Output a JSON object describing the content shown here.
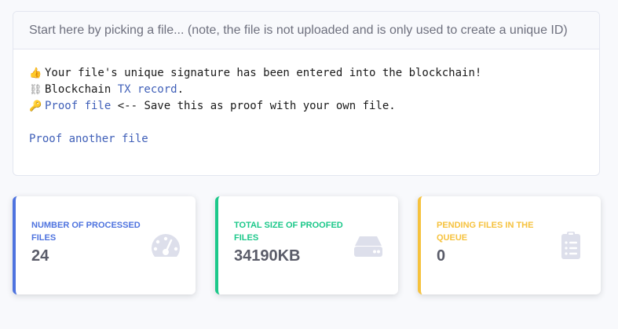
{
  "upload": {
    "header_text": "Start here by picking a file... (note, the file is not uploaded and is only used to create a unique ID)",
    "lines": {
      "signature": {
        "emoji": "👍",
        "text": "Your file's unique signature has been entered into the blockchain!"
      },
      "tx": {
        "emoji": "⛓",
        "prefix": "Blockchain ",
        "link": "TX record",
        "suffix": "."
      },
      "proof": {
        "emoji": "🔑",
        "link": "Proof file",
        "suffix": " <-- Save this as proof with your own file."
      },
      "another": {
        "link": "Proof another file"
      }
    }
  },
  "stats": {
    "processed": {
      "label": "Number of processed files",
      "value": "24",
      "color": "#4e73df",
      "icon": "tachometer-icon"
    },
    "size": {
      "label": "Total size of proofed files",
      "value": "34190KB",
      "color": "#1cc88a",
      "icon": "hdd-icon"
    },
    "pending": {
      "label": "Pending files in the queue",
      "value": "0",
      "color": "#f6c23e",
      "icon": "clipboard-list-icon"
    }
  }
}
